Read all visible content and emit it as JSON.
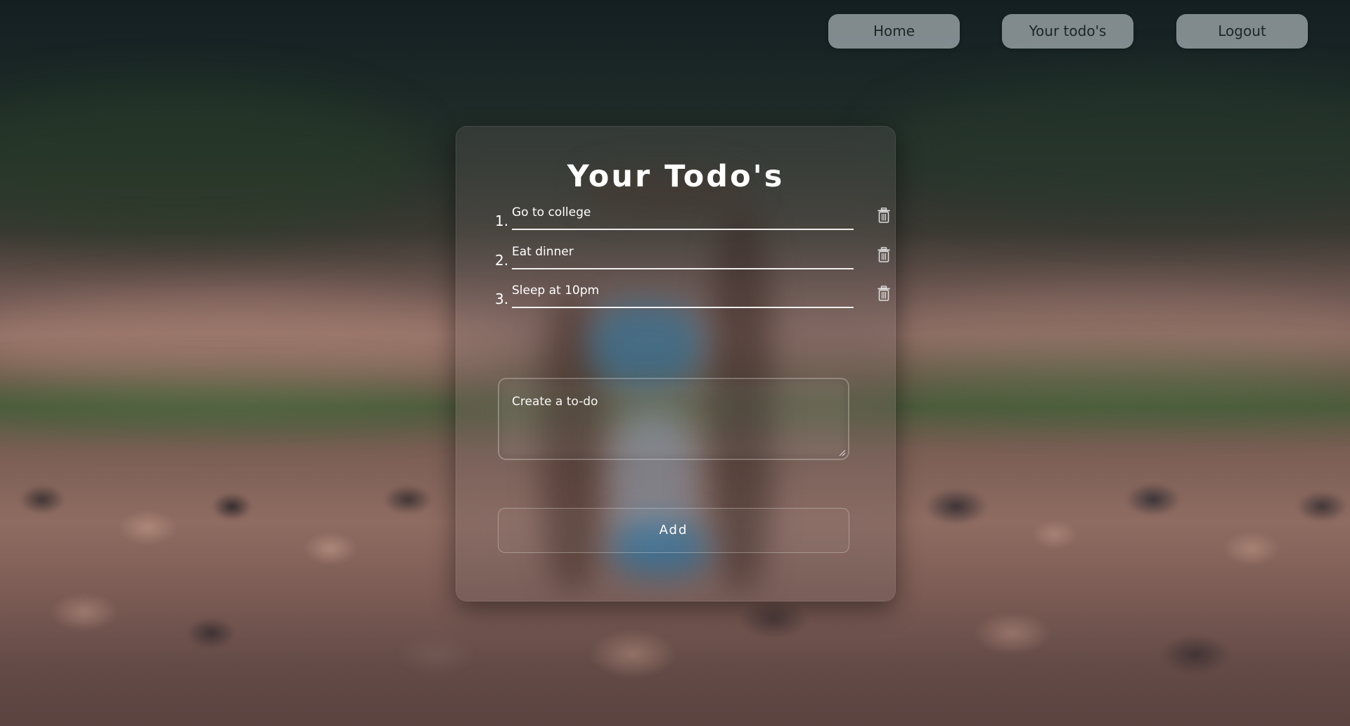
{
  "nav": {
    "home_label": "Home",
    "todos_label": "Your todo's",
    "logout_label": "Logout"
  },
  "card": {
    "title": "Your Todo's",
    "todos": [
      {
        "number": "1.",
        "text": "Go to college",
        "delete_icon": "trash-icon"
      },
      {
        "number": "2.",
        "text": "Eat dinner",
        "delete_icon": "trash-icon"
      },
      {
        "number": "3.",
        "text": "Sleep at 10pm",
        "delete_icon": "trash-icon"
      }
    ],
    "new_todo_placeholder": "Create a to-do",
    "add_label": "Add"
  },
  "colors": {
    "nav_button_bg": "#aab4b8",
    "nav_button_text": "#1c2426",
    "card_text": "#ffffff"
  }
}
